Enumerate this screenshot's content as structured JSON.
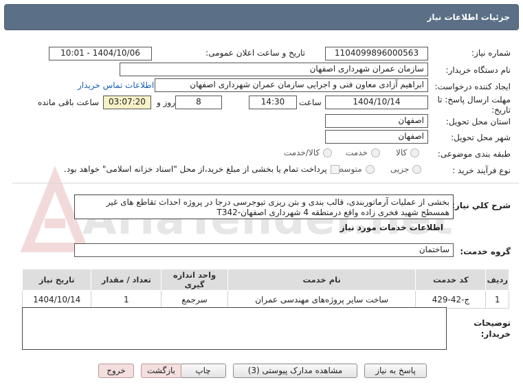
{
  "window": {
    "title": "جزئیات اطلاعات نیاز"
  },
  "watermark": "AriaTender.net",
  "fields": {
    "need_number": {
      "label": "شماره نیاز:",
      "value": "1104099896000563"
    },
    "announce_datetime": {
      "label": "تاریخ و ساعت اعلان عمومی:",
      "value": "1404/10/06 - 10:01"
    },
    "buyer_org": {
      "label": "نام دستگاه خریدار:",
      "value": "سازمان عمران شهرداری اصفهان"
    },
    "creator": {
      "label": "ایجاد کننده درخواست:",
      "value": "ابراهیم آزادی معاون فنی و اجرایی سازمان عمران شهرداری اصفهان",
      "link": "اطلاعات تماس خریدار"
    },
    "deadline": {
      "label": "مهلت ارسال پاسخ: تا تاریخ:",
      "date": "1404/10/14",
      "time_label": "ساعت",
      "time": "14:30",
      "days": "8",
      "days_label": "روز و",
      "remaining": "03:07:20",
      "remaining_label": "ساعت باقی مانده"
    },
    "province": {
      "label": "استان محل تحویل:",
      "value": "اصفهان"
    },
    "city": {
      "label": "شهر محل تحویل:",
      "value": "اصفهان"
    },
    "category": {
      "label": "طبقه بندی موضوعی:",
      "options": [
        "کالا",
        "خدمت",
        "کالا/خدمت"
      ]
    },
    "purchase_type": {
      "label": "نوع فرآیند خرید :",
      "options": [
        "جزیی",
        "متوسط"
      ],
      "note": "پرداخت تمام یا بخشی از مبلغ خرید،از محل \"اسناد خزانه اسلامی\" خواهد بود."
    }
  },
  "description": {
    "label": "شرح کلي نياز:",
    "text": "بخشی از عملیات آرماتوربندی، قالب بندی و بتن ریزی تیوجرسی درجا در پروژه احداث تقاطع های غیر همسطح شهید فخری زاده واقع درمنطقه 4 شهرداری اصفهان-T342"
  },
  "services_header": "اطلاعات خدمات مورد نياز",
  "service_group": {
    "label": "گروه خدمت:",
    "value": "ساختمان"
  },
  "table": {
    "headers": [
      "ردیف",
      "کد خدمت",
      "نام خدمت",
      "واحد اندازه گیری",
      "تعداد / مقدار",
      "تاریخ نیاز"
    ],
    "rows": [
      [
        "1",
        "ج-42-429",
        "ساخت سایر پروژه‌های مهندسی عمران",
        "سرجمع",
        "1",
        "1404/10/14"
      ]
    ]
  },
  "buyer_notes": {
    "label": "توضیحات خریدار:",
    "value": ""
  },
  "buttons": {
    "respond": "پاسخ به نیاز",
    "attachments": "مشاهده مدارک پیوستی (3)",
    "print": "چاپ",
    "back": "بازگشت",
    "exit": "خروج"
  }
}
